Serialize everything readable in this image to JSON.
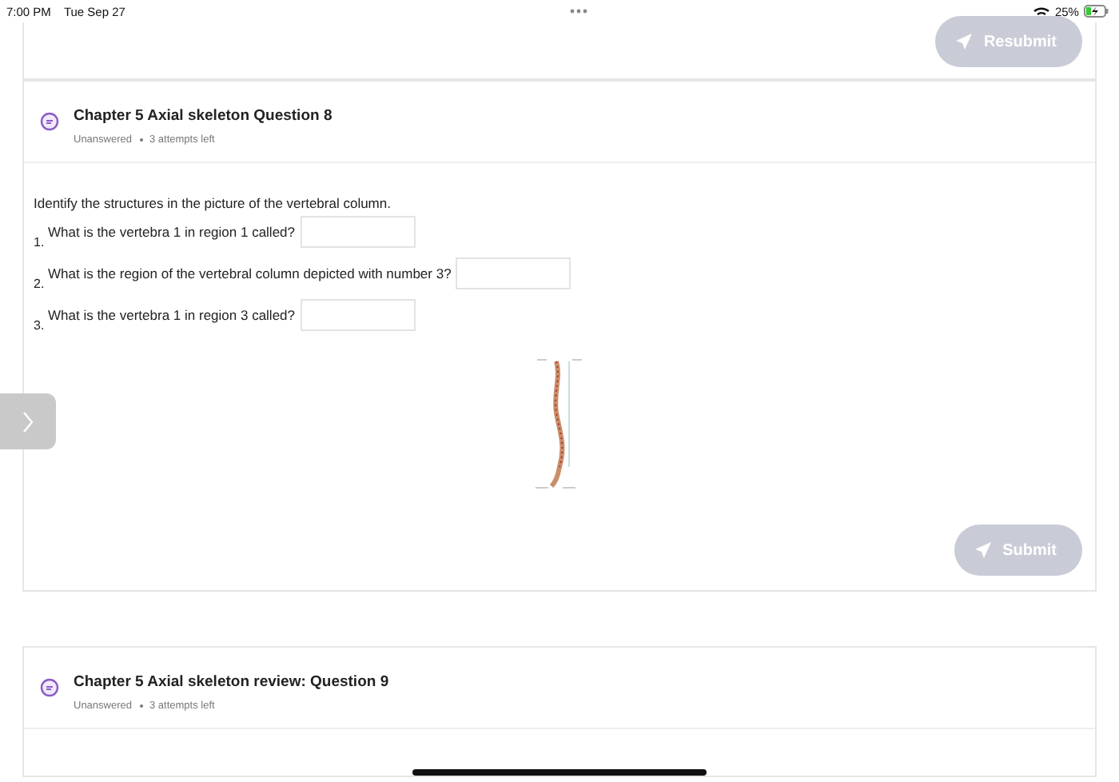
{
  "status_bar": {
    "time": "7:00 PM",
    "date": "Tue Sep 27",
    "battery": "25%",
    "charging": true
  },
  "previous_card": {
    "button": {
      "label": "Resubmit",
      "disabled": true
    }
  },
  "questions": [
    {
      "title": "Chapter 5 Axial skeleton Question 8",
      "status": "Unanswered",
      "attempts": "3 attempts left",
      "prompt": "Identify the structures in the picture of the vertebral column.",
      "items": [
        {
          "number": "1.",
          "text": "What is the vertebra 1 in region 1 called?"
        },
        {
          "number": "2.",
          "text": "What is the region of the vertebral column depicted with number 3?"
        },
        {
          "number": "3.",
          "text": "What is the vertebra 1 in region 3 called?"
        }
      ],
      "button": {
        "label": "Submit",
        "disabled": true
      }
    },
    {
      "title": "Chapter 5 Axial skeleton review: Question 9",
      "status": "Unanswered",
      "attempts": "3 attempts left"
    }
  ]
}
